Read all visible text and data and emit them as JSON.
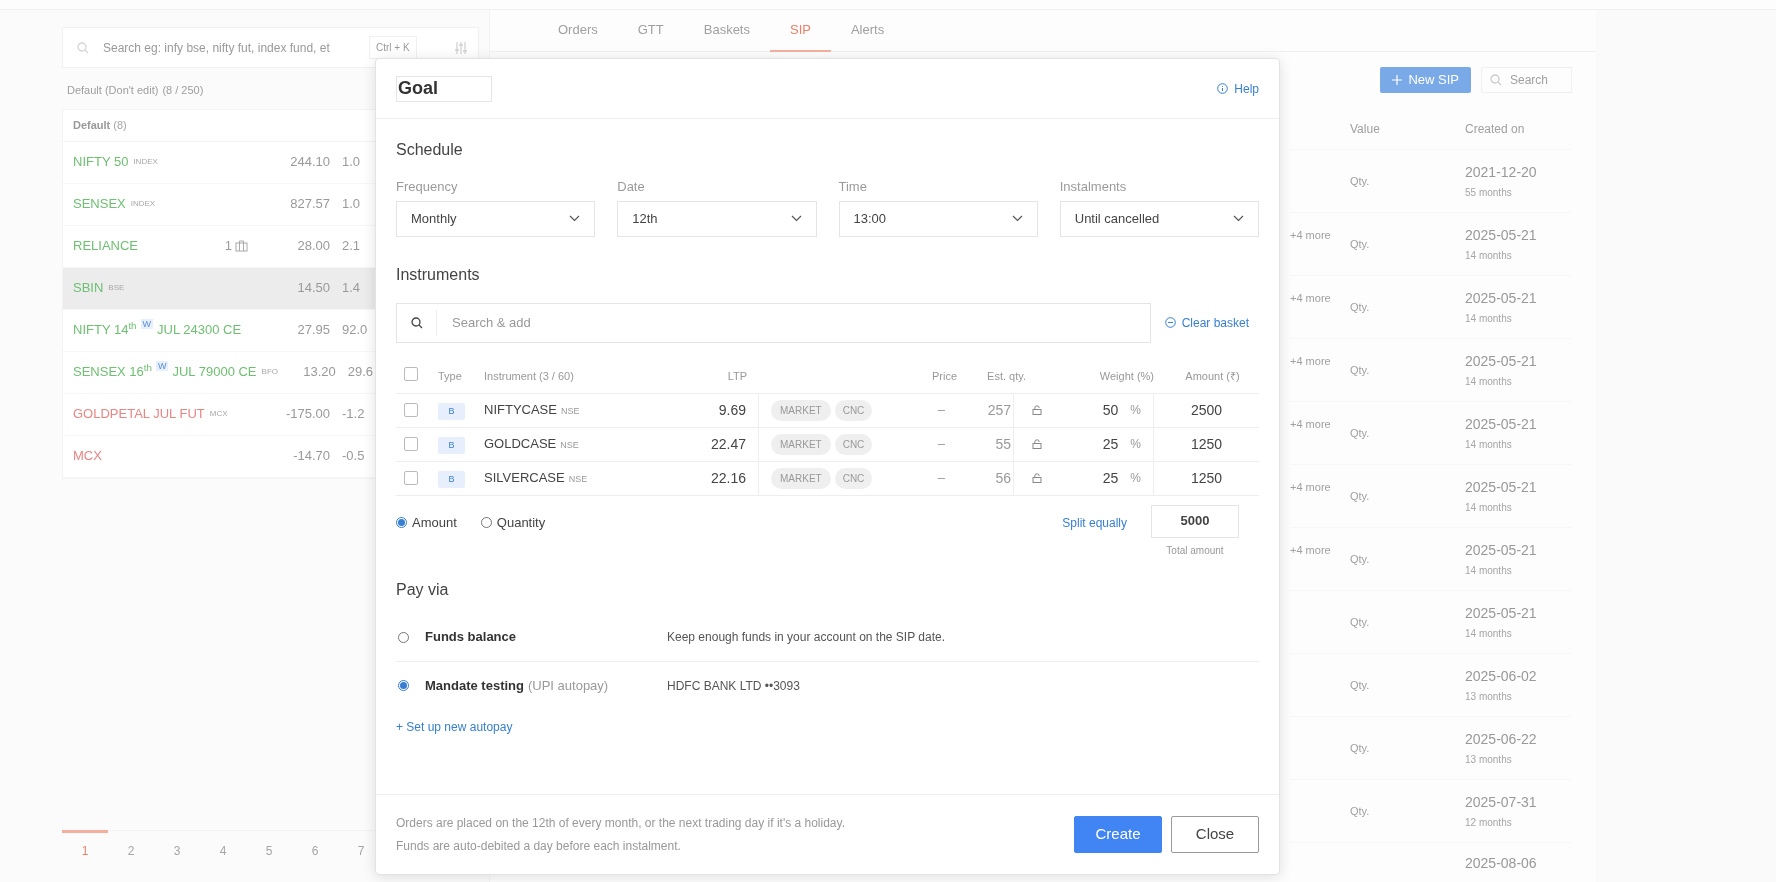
{
  "watchlist": {
    "search": {
      "placeholder": "Search eg: infy bse, nifty fut, index fund, et",
      "shortcut": "Ctrl + K"
    },
    "list_title": "Default (Don't edit)",
    "list_count": "(8 / 250)",
    "group": {
      "name": "Default",
      "count": "(8)"
    },
    "items": [
      {
        "name": "NIFTY 50",
        "tag": "INDEX",
        "price": "244.10",
        "change": "1.0",
        "color": "#6fbf73",
        "selected": false
      },
      {
        "name": "SENSEX",
        "tag": "INDEX",
        "price": "827.57",
        "change": "1.0",
        "color": "#6fbf73",
        "selected": false
      },
      {
        "name": "RELIANCE",
        "holdings": "1",
        "price": "28.00",
        "change": "2.1",
        "color": "#6fbf73",
        "selected": false
      },
      {
        "name": "SBIN",
        "tag": "BSE",
        "price": "14.50",
        "change": "1.4",
        "color": "#6fbf73",
        "selected": true
      },
      {
        "name": "NIFTY 14$^{th}$",
        "weekly": "W",
        "name_rest": "JUL 24300 CE",
        "price": "27.95",
        "change": "92.0",
        "color": "#6fbf73",
        "selected": false
      },
      {
        "name": "SENSEX 16$^{th}$",
        "weekly": "W",
        "name_rest": "JUL 79000 CE",
        "tag": "BFO",
        "price": "13.20",
        "change": "29.6",
        "color": "#6fbf73",
        "selected": false
      },
      {
        "name": "GOLDPETAL JUL FUT",
        "tag": "MCX",
        "price": "-175.00",
        "change": "-1.2",
        "color": "#e88585",
        "selected": false
      },
      {
        "name": "MCX",
        "price": "-14.70",
        "change": "-0.5",
        "color": "#e88585",
        "selected": false
      }
    ],
    "pages": [
      {
        "label": "1",
        "selected": true
      },
      {
        "label": "2",
        "selected": false
      },
      {
        "label": "3",
        "selected": false
      },
      {
        "label": "4",
        "selected": false
      },
      {
        "label": "5",
        "selected": false
      },
      {
        "label": "6",
        "selected": false
      },
      {
        "label": "7",
        "selected": false
      }
    ]
  },
  "tabs": [
    {
      "label": "Orders",
      "selected": false
    },
    {
      "label": "GTT",
      "selected": false
    },
    {
      "label": "Baskets",
      "selected": false
    },
    {
      "label": "SIP",
      "selected": true
    },
    {
      "label": "Alerts",
      "selected": false
    }
  ],
  "sip_list": {
    "new_button": "New SIP",
    "search": {
      "placeholder": "Search"
    },
    "columns": [
      "Value",
      "Created on"
    ],
    "rows": [
      {
        "value": "Qty.",
        "created": "2021-12-20",
        "age": "55 months"
      },
      {
        "more": "+4 more",
        "value": "Qty.",
        "created": "2025-05-21",
        "age": "14 months"
      },
      {
        "more": "+4 more",
        "value": "Qty.",
        "created": "2025-05-21",
        "age": "14 months"
      },
      {
        "more": "+4 more",
        "value": "Qty.",
        "created": "2025-05-21",
        "age": "14 months"
      },
      {
        "more": "+4 more",
        "value": "Qty.",
        "created": "2025-05-21",
        "age": "14 months"
      },
      {
        "more": "+4 more",
        "value": "Qty.",
        "created": "2025-05-21",
        "age": "14 months"
      },
      {
        "more": "+4 more",
        "value": "Qty.",
        "created": "2025-05-21",
        "age": "14 months"
      },
      {
        "value": "Qty.",
        "created": "2025-05-21",
        "age": "14 months"
      },
      {
        "value": "Qty.",
        "created": "2025-06-02",
        "age": "13 months"
      },
      {
        "value": "Qty.",
        "created": "2025-06-22",
        "age": "13 months"
      },
      {
        "value": "Qty.",
        "created": "2025-07-31",
        "age": "12 months"
      },
      {
        "created": "2025-08-06"
      }
    ]
  },
  "dialog": {
    "title": "Goal",
    "help": "Help",
    "schedule": {
      "title": "Schedule",
      "fields": [
        {
          "label": "Frequency",
          "value": "Monthly"
        },
        {
          "label": "Date",
          "value": "12th"
        },
        {
          "label": "Time",
          "value": "13:00"
        },
        {
          "label": "Instalments",
          "value": "Until cancelled"
        }
      ]
    },
    "instruments": {
      "title": "Instruments",
      "search": {
        "placeholder": "Search & add"
      },
      "clear": "Clear basket",
      "all_checked": false,
      "columns": [
        "Type",
        "Instrument (3 / 60)",
        "LTP",
        "Price",
        "Est. qty.",
        "Weight (%)",
        "Amount (₹)"
      ],
      "rows": [
        {
          "checked": false,
          "type": "B",
          "name": "NIFTYCASE",
          "exchange": "NSE",
          "ltp": "9.69",
          "order_type": "MARKET",
          "product": "CNC",
          "price": "–",
          "est_qty": "257",
          "weight": "50",
          "unit": "%",
          "amount": "2500"
        },
        {
          "checked": false,
          "type": "B",
          "name": "GOLDCASE",
          "exchange": "NSE",
          "ltp": "22.47",
          "order_type": "MARKET",
          "product": "CNC",
          "price": "–",
          "est_qty": "55",
          "weight": "25",
          "unit": "%",
          "amount": "1250"
        },
        {
          "checked": false,
          "type": "B",
          "name": "SILVERCASE",
          "exchange": "NSE",
          "ltp": "22.16",
          "order_type": "MARKET",
          "product": "CNC",
          "price": "–",
          "est_qty": "56",
          "weight": "25",
          "unit": "%",
          "amount": "1250"
        }
      ],
      "modes": [
        {
          "label": "Amount",
          "selected": true
        },
        {
          "label": "Quantity",
          "selected": false
        }
      ],
      "split": "Split equally",
      "total": "5000",
      "total_label": "Total amount"
    },
    "pay_via": {
      "title": "Pay via",
      "options": [
        {
          "title": "Funds balance",
          "description": "Keep enough funds in your account on the SIP date.",
          "selected": false
        },
        {
          "title": "Mandate testing",
          "subtitle": "(UPI autopay)",
          "description": "HDFC BANK LTD ••3093",
          "selected": true
        }
      ],
      "setup_link": "+ Set up new autopay"
    },
    "footer": {
      "notes": [
        "Orders are placed on the 12th of every month, or the next trading day if it's a holiday.",
        "Funds are auto-debited a day before each instalment."
      ],
      "buttons": [
        {
          "label": "Create",
          "kind": "primary"
        },
        {
          "label": "Close",
          "kind": "secondary"
        }
      ]
    }
  }
}
